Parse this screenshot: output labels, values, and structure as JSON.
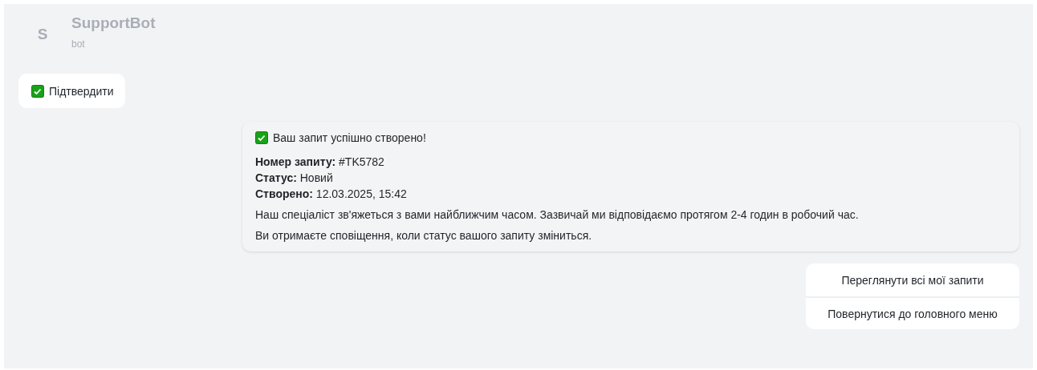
{
  "header": {
    "avatar": "S",
    "name": "SupportBot",
    "role": "bot"
  },
  "confirm_button": {
    "label": "Підтвердити"
  },
  "message": {
    "title": "Ваш запит успішно створено!",
    "fields": [
      "**Номер запиту:** #TK5782",
      "**Статус:** Новий",
      "**Створено:** 12.03.2025, 15:42"
    ],
    "paragraphs": [
      "Наш спеціаліст зв'яжеться з вами найближчим часом. Зазвичай ми відповідаємо протягом 2-4 годин в робочий час.",
      "Ви отримаєте сповіщення, коли статус вашого запиту зміниться."
    ]
  },
  "actions": [
    "Переглянути всі мої запити",
    "Повернутися до головного меню"
  ]
}
